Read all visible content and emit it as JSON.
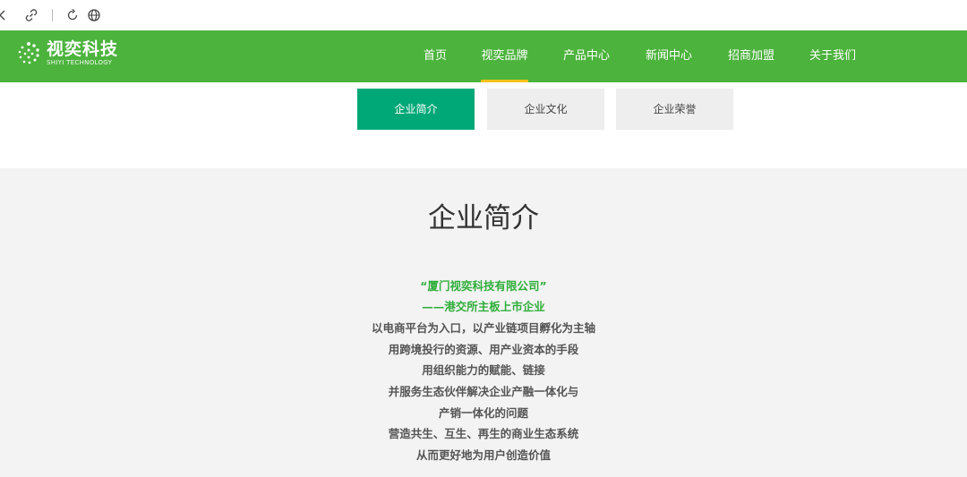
{
  "browser": {
    "back_icon": "chevron-left-icon",
    "link_icon": "link-icon",
    "reload_icon": "reload-icon",
    "globe_icon": "globe-icon"
  },
  "header": {
    "logo_cn": "视奕科技",
    "logo_en": "SHIYI TECHNOLOGY",
    "bg_color": "#4cb33d",
    "active_indicator_color": "#f5c21b",
    "nav": [
      "首页",
      "视奕品牌",
      "产品中心",
      "新闻中心",
      "招商加盟",
      "关于我们"
    ],
    "active_nav": "视奕品牌"
  },
  "subtabs": {
    "items": [
      "企业简介",
      "企业文化",
      "企业荣誉"
    ],
    "active": "企业简介",
    "active_color": "#00a877"
  },
  "section": {
    "title": "企业简介",
    "green_lines": [
      "“厦门视奕科技有限公司”",
      "——港交所主板上市企业"
    ],
    "body_lines": [
      "以电商平台为入口，以产业链项目孵化为主轴",
      "用跨境投行的资源、用产业资本的手段",
      "用组织能力的赋能、链接",
      "并服务生态伙伴解决企业产融一体化与",
      "产销一体化的问题",
      "营造共生、互生、再生的商业生态系统",
      "从而更好地为用户创造价值"
    ]
  }
}
